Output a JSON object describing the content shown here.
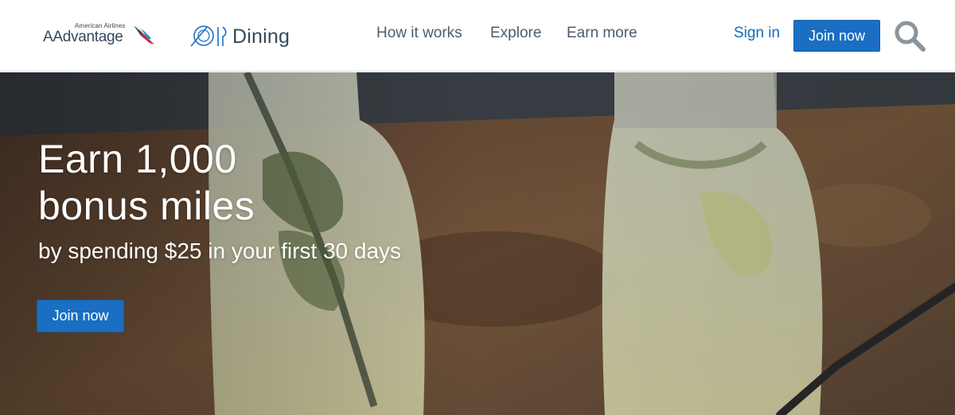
{
  "brand": {
    "airline_text": "American Airlines",
    "program_text": "AAdvantage",
    "flight_symbol_icon": "american-airlines-flight-symbol-icon"
  },
  "dining_logo": {
    "icon": "plate-fork-knife-icon",
    "text": "Dining"
  },
  "nav": {
    "items": [
      {
        "label": "How it works"
      },
      {
        "label": "Explore"
      },
      {
        "label": "Earn more"
      }
    ]
  },
  "header_actions": {
    "sign_in": "Sign in",
    "join_now": "Join now",
    "search_icon": "search-icon"
  },
  "hero": {
    "headline_line1": "Earn 1,000",
    "headline_line2": "bonus miles",
    "subheadline": "by spending $25 in your first 30 days",
    "cta": "Join now"
  },
  "colors": {
    "accent_blue": "#1a6fc2",
    "link_blue": "#0f6dc0",
    "nav_text": "#4c5c6b",
    "brand_text": "#36495a"
  }
}
